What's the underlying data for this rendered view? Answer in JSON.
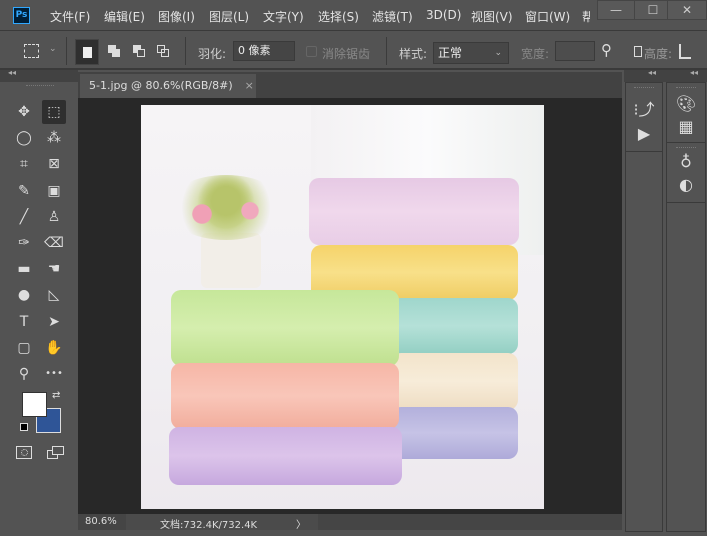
{
  "app": {
    "logo": "Ps"
  },
  "menu": [
    "文件(F)",
    "编辑(E)",
    "图像(I)",
    "图层(L)",
    "文字(Y)",
    "选择(S)",
    "滤镜(T)",
    "3D(D)",
    "视图(V)",
    "窗口(W)",
    "帮"
  ],
  "window_controls": {
    "minimize": "—",
    "maximize": "☐",
    "close": "✕"
  },
  "options": {
    "feather_label": "羽化:",
    "feather_value": "0 像素",
    "antialias_label": "消除锯齿",
    "style_label": "样式:",
    "style_value": "正常",
    "width_label": "宽度:",
    "height_label": "高度:"
  },
  "document": {
    "tab_title": "5-1.jpg @ 80.6%(RGB/8#)",
    "close": "×"
  },
  "status": {
    "zoom": "80.6%",
    "doc_info": "文档:732.4K/732.4K",
    "arrow": "〉"
  },
  "colors": {
    "foreground": "#ffffff",
    "background": "#2f5597",
    "accent": "#31a8ff"
  },
  "tools": [
    "move-tool",
    "rectangular-marquee-tool",
    "lasso-tool",
    "magic-wand-tool",
    "crop-tool",
    "frame-tool",
    "eyedropper-tool",
    "object-selection-tool",
    "brush-tool",
    "clone-stamp-tool",
    "history-brush-tool",
    "eraser-tool",
    "gradient-tool",
    "smudge-tool",
    "dodge-tool",
    "pen-tool",
    "type-tool",
    "path-selection-tool",
    "rectangle-tool",
    "hand-tool",
    "zoom-tool",
    "more-tools"
  ]
}
